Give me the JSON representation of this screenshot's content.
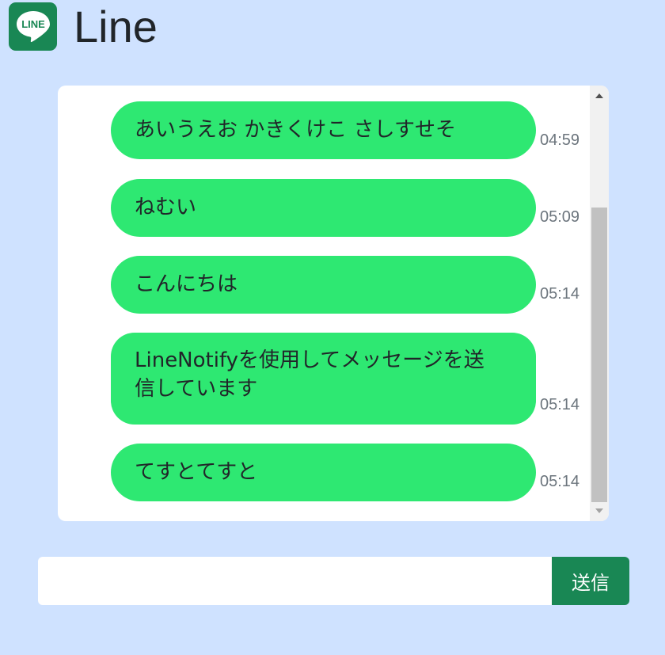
{
  "app": {
    "title": "Line",
    "logo_text": "LINE",
    "logo_icon": "line-chat-bubble-icon",
    "accent": "#198754",
    "bubble_color": "#2ee872"
  },
  "messages": [
    {
      "text": "あいうえお かきくけこ さしすせそ",
      "time": "04:59"
    },
    {
      "text": "ねむい",
      "time": "05:09"
    },
    {
      "text": "こんにちは",
      "time": "05:14"
    },
    {
      "text": "LineNotifyを使用してメッセージを送信しています",
      "time": "05:14"
    },
    {
      "text": "てすとてすと",
      "time": "05:14"
    }
  ],
  "composer": {
    "value": "",
    "placeholder": "",
    "send_label": "送信"
  }
}
